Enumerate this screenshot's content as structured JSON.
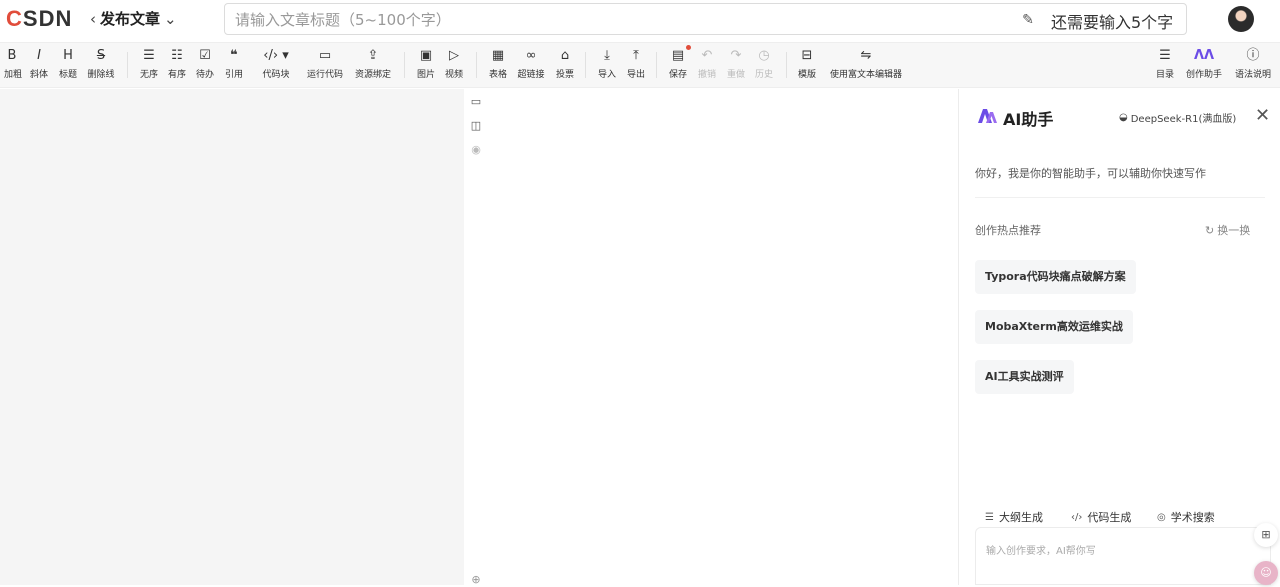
{
  "header": {
    "logo": "CSDN",
    "back_label": "发布文章",
    "title_placeholder": "请输入文章标题（5~100个字）",
    "remaining": "还需要输入5个字"
  },
  "toolbar": {
    "bold": "加粗",
    "italic": "斜体",
    "heading": "标题",
    "strike": "删除线",
    "ul": "无序",
    "ol": "有序",
    "todo": "待办",
    "quote": "引用",
    "code": "代码块",
    "run_code": "运行代码",
    "resource": "资源绑定",
    "image": "图片",
    "video": "视频",
    "table": "表格",
    "link": "超链接",
    "vote": "投票",
    "import": "导入",
    "export": "导出",
    "save": "保存",
    "undo": "撤销",
    "redo": "重做",
    "history": "历史",
    "template": "模版",
    "rich_editor": "使用富文本编辑器",
    "toc": "目录",
    "assistant": "创作助手",
    "syntax": "语法说明",
    "glyphs": {
      "bold": "B",
      "italic": "I",
      "heading": "H",
      "strike": "S"
    }
  },
  "ai_panel": {
    "title": "AI助手",
    "model": "DeepSeek-R1(满血版)",
    "greeting": "你好，我是你的智能助手，可以辅助你快速写作",
    "hot_title": "创作热点推荐",
    "refresh": "换一换",
    "topics": [
      "Typora代码块痛点破解方案",
      "MobaXterm高效运维实战",
      "AI工具实战测评"
    ],
    "tools": {
      "outline": "大纲生成",
      "code": "代码生成",
      "search": "学术搜索"
    },
    "input_placeholder": "输入创作要求，AI帮你写"
  },
  "colors": {
    "brand": "#e14d3b",
    "ai_accent": "#6b4ce6"
  }
}
